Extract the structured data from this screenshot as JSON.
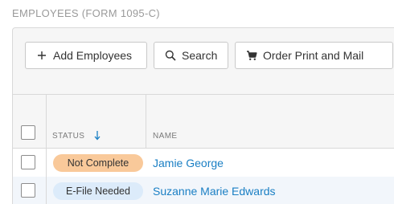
{
  "section": {
    "title": "EMPLOYEES (FORM 1095-C)"
  },
  "toolbar": {
    "add_label": "Add Employees",
    "search_label": "Search",
    "order_label": "Order Print and Mail"
  },
  "table": {
    "columns": {
      "status": "STATUS",
      "name": "NAME"
    },
    "sort": {
      "column": "status",
      "direction": "descending"
    },
    "rows": [
      {
        "status": "Not Complete",
        "status_color": "#f9c99a",
        "name": "Jamie George"
      },
      {
        "status": "E-File Needed",
        "status_color": "#dcebfa",
        "name": "Suzanne Marie Edwards"
      }
    ]
  },
  "colors": {
    "link": "#1a7fc4",
    "sort_arrow": "#1a7fc4"
  },
  "icons": {
    "add": "plus-icon",
    "search": "search-icon",
    "order": "cart-icon",
    "sort": "arrow-down-icon"
  }
}
